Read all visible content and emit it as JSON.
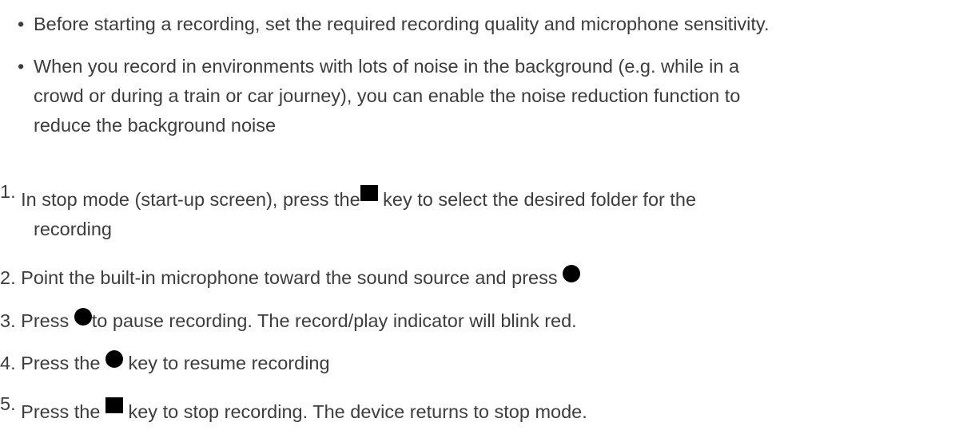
{
  "bullets": [
    {
      "text": "Before starting a recording, set the required recording quality and microphone sensitivity."
    },
    {
      "line1": "When you record in environments with lots of noise in the background (e.g. while in a",
      "line2": "crowd or during a train or car journey), you can enable the noise reduction function to",
      "line3": "reduce the background noise"
    }
  ],
  "steps": [
    {
      "number": "1.",
      "before": "In stop mode (start-up screen), press the",
      "icon": "stop-square-icon",
      "after": " key to select the desired folder for the",
      "continuation": "recording"
    },
    {
      "number": "2.",
      "before": "Point the built-in microphone toward the sound source and press",
      "icon": "record-circle-icon",
      "after": ""
    },
    {
      "number": "3.",
      "before": "Press ",
      "icon": "record-circle-icon",
      "after": "to pause recording. The record/play indicator will blink red."
    },
    {
      "number": "4.",
      "before": "Press the ",
      "icon": "record-circle-icon",
      "after": " key to resume recording"
    },
    {
      "number": "5.",
      "before": "Press the ",
      "icon": "stop-square-icon",
      "after": " key to stop recording. The device returns to stop mode."
    }
  ]
}
